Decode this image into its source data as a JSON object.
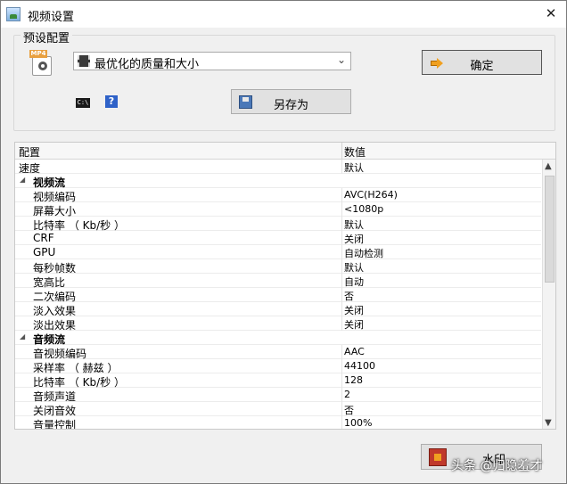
{
  "window": {
    "title": "视频设置",
    "close_glyph": "✕"
  },
  "preset": {
    "group_label": "预设配置",
    "mp4_tag": "MP4",
    "selected": "最优化的质量和大小",
    "dropdown_glyph": "⌄",
    "cmd_label": "C:\\",
    "help_label": "?"
  },
  "buttons": {
    "ok": "确定",
    "save_as": "另存为",
    "stop": "水印"
  },
  "grid": {
    "header": {
      "name": "配置",
      "value": "数值"
    },
    "rows": [
      {
        "kind": "top",
        "name": "速度",
        "value": "默认"
      },
      {
        "kind": "category",
        "name": "视频流",
        "value": ""
      },
      {
        "kind": "item",
        "name": "视频编码",
        "value": "AVC(H264)"
      },
      {
        "kind": "item",
        "name": "屏幕大小",
        "value": "<1080p"
      },
      {
        "kind": "item",
        "name": "比特率 （ Kb/秒 ）",
        "value": "默认"
      },
      {
        "kind": "item",
        "name": "CRF",
        "value": "关闭"
      },
      {
        "kind": "item",
        "name": "GPU",
        "value": "自动检测"
      },
      {
        "kind": "item",
        "name": "每秒帧数",
        "value": "默认"
      },
      {
        "kind": "item",
        "name": "宽高比",
        "value": "自动"
      },
      {
        "kind": "item",
        "name": "二次编码",
        "value": "否"
      },
      {
        "kind": "item",
        "name": "淡入效果",
        "value": "关闭"
      },
      {
        "kind": "item",
        "name": "淡出效果",
        "value": "关闭"
      },
      {
        "kind": "category",
        "name": "音频流",
        "value": ""
      },
      {
        "kind": "item",
        "name": "音视频编码",
        "value": "AAC"
      },
      {
        "kind": "item",
        "name": "采样率 （ 赫兹 ）",
        "value": "44100"
      },
      {
        "kind": "item",
        "name": "比特率 （ Kb/秒 ）",
        "value": "128"
      },
      {
        "kind": "item",
        "name": "音频声道",
        "value": "2"
      },
      {
        "kind": "item",
        "name": "关闭音效",
        "value": "否"
      },
      {
        "kind": "item",
        "name": "音量控制",
        "value": "100%"
      }
    ],
    "collapse_glyph": "◢",
    "scroll_up_glyph": "▲",
    "scroll_down_glyph": "▼"
  },
  "watermark": "头条 @归隐羞才"
}
